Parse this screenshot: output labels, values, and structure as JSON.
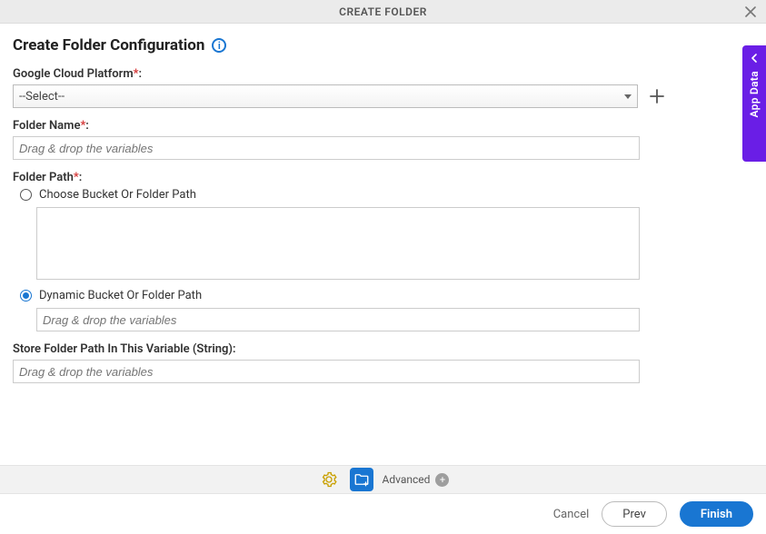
{
  "titlebar": {
    "title": "CREATE FOLDER"
  },
  "heading": "Create Folder Configuration",
  "fields": {
    "gcp": {
      "label": "Google Cloud Platform",
      "required_marker": "*",
      "select_value": "--Select--"
    },
    "folder_name": {
      "label": "Folder Name",
      "required_marker": "*",
      "placeholder": "Drag & drop the variables"
    },
    "folder_path": {
      "label": "Folder Path",
      "required_marker": "*",
      "choose_label": "Choose Bucket Or Folder Path",
      "dynamic_label": "Dynamic Bucket Or Folder Path",
      "dynamic_placeholder": "Drag & drop the variables",
      "selected": "dynamic"
    },
    "store_var": {
      "label": "Store Folder Path In This Variable (String):",
      "placeholder": "Drag & drop the variables"
    }
  },
  "side_tab": {
    "label": "App Data"
  },
  "toolbar": {
    "advanced_label": "Advanced"
  },
  "footer": {
    "cancel": "Cancel",
    "prev": "Prev",
    "finish": "Finish"
  }
}
